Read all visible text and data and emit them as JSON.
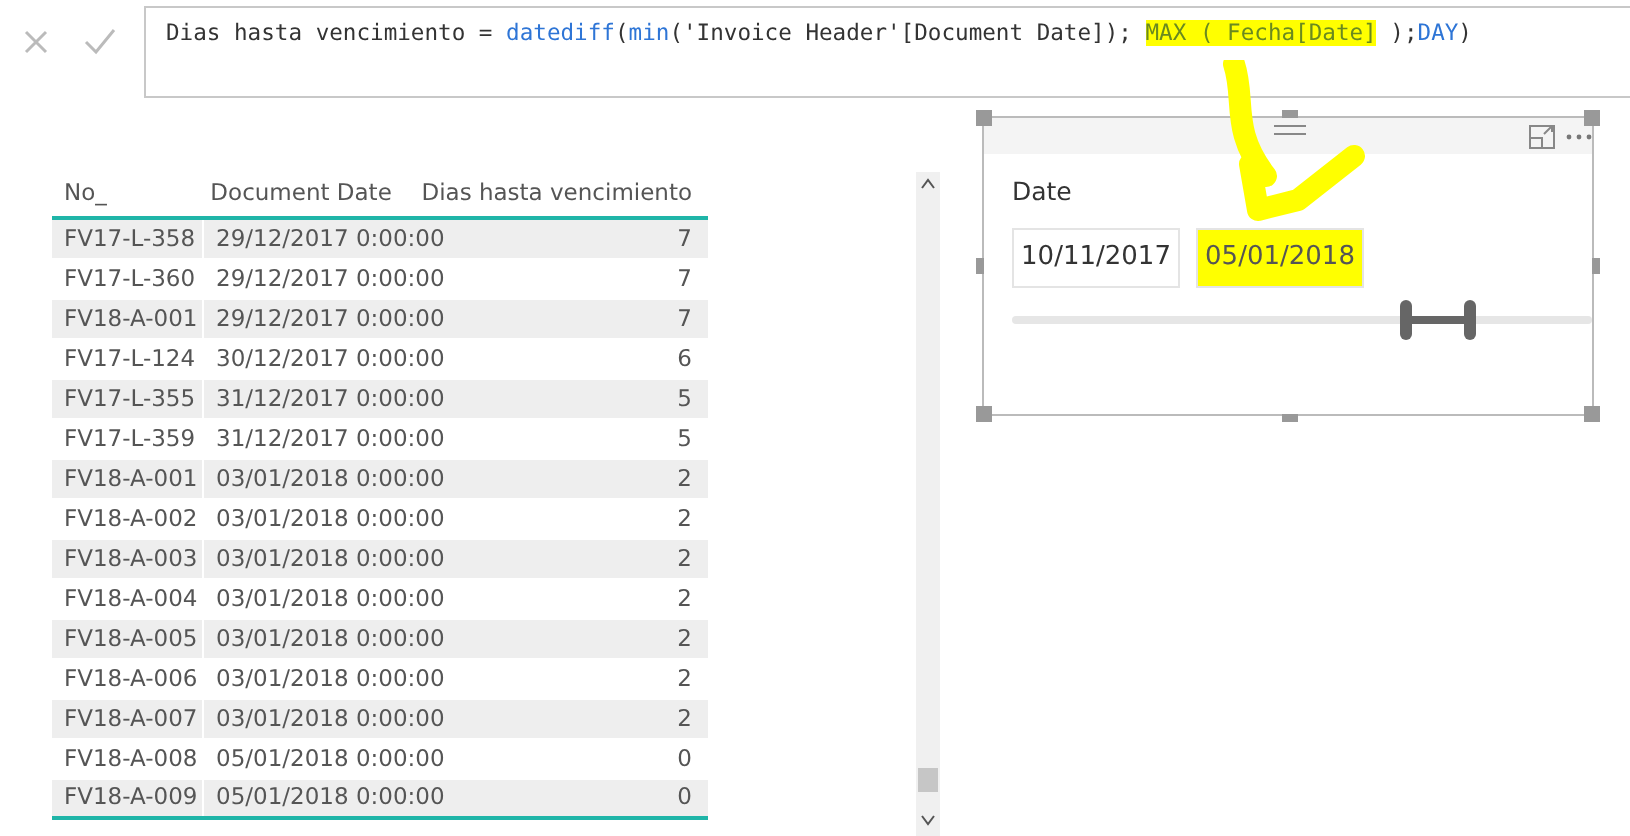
{
  "formula_bar": {
    "cancel_disabled": true,
    "commit_disabled": true,
    "formula": [
      {
        "kind": "plain",
        "text": "Dias hasta vencimiento = "
      },
      {
        "kind": "function",
        "text": "datediff"
      },
      {
        "kind": "plain",
        "text": "("
      },
      {
        "kind": "function",
        "text": "min"
      },
      {
        "kind": "plain",
        "text": "('Invoice Header'[Document Date]); "
      },
      {
        "kind": "highlight",
        "text": "MAX ( Fecha[Date]"
      },
      {
        "kind": "plain",
        "text": " );"
      },
      {
        "kind": "function",
        "text": "DAY"
      },
      {
        "kind": "plain",
        "text": ")"
      }
    ]
  },
  "table": {
    "columns": [
      "No_",
      "Document Date",
      "Dias hasta vencimiento"
    ],
    "rows": [
      [
        "FV17-L-358",
        "29/12/2017 0:00:00",
        "7"
      ],
      [
        "FV17-L-360",
        "29/12/2017 0:00:00",
        "7"
      ],
      [
        "FV18-A-001",
        "29/12/2017 0:00:00",
        "7"
      ],
      [
        "FV17-L-124",
        "30/12/2017 0:00:00",
        "6"
      ],
      [
        "FV17-L-355",
        "31/12/2017 0:00:00",
        "5"
      ],
      [
        "FV17-L-359",
        "31/12/2017 0:00:00",
        "5"
      ],
      [
        "FV18-A-001",
        "03/01/2018 0:00:00",
        "2"
      ],
      [
        "FV18-A-002",
        "03/01/2018 0:00:00",
        "2"
      ],
      [
        "FV18-A-003",
        "03/01/2018 0:00:00",
        "2"
      ],
      [
        "FV18-A-004",
        "03/01/2018 0:00:00",
        "2"
      ],
      [
        "FV18-A-005",
        "03/01/2018 0:00:00",
        "2"
      ],
      [
        "FV18-A-006",
        "03/01/2018 0:00:00",
        "2"
      ],
      [
        "FV18-A-007",
        "03/01/2018 0:00:00",
        "2"
      ],
      [
        "FV18-A-008",
        "05/01/2018 0:00:00",
        "0"
      ],
      [
        "FV18-A-009",
        "05/01/2018 0:00:00",
        "0"
      ]
    ]
  },
  "slicer": {
    "title": "Date",
    "fields": [
      {
        "value": "10/11/2017",
        "highlighted": false
      },
      {
        "value": "05/01/2018",
        "highlighted": true
      }
    ],
    "thumbs": [
      {
        "level": 0.68
      },
      {
        "level": 0.79
      }
    ]
  }
}
